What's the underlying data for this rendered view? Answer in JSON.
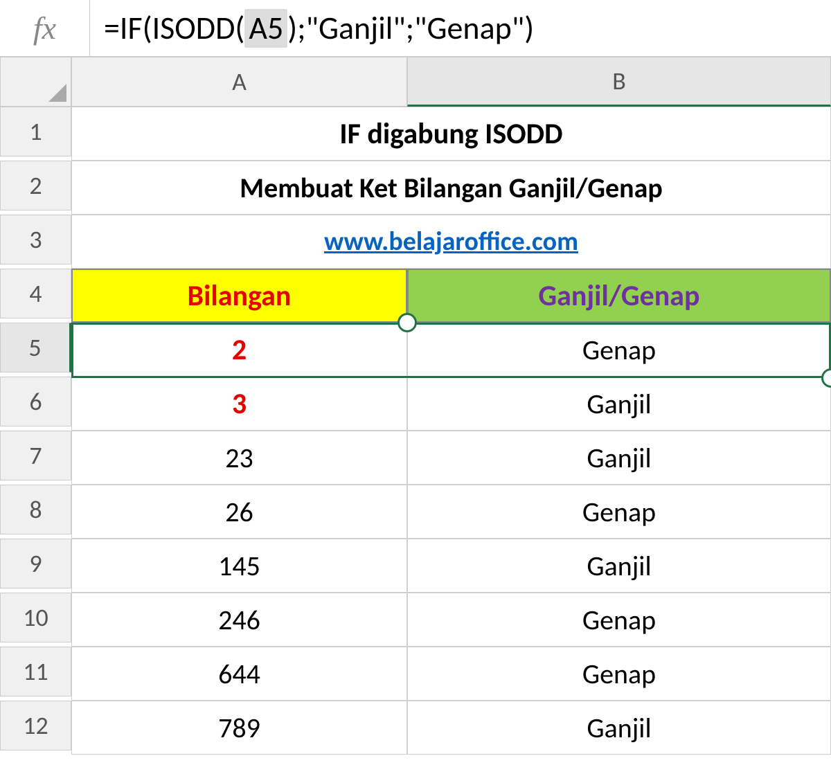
{
  "formula_bar": {
    "fx": "fx",
    "pre": "=IF(ISODD(",
    "ref": " A5 ",
    "post": ");\"Ganjil\";\"Genap\")"
  },
  "columns": [
    "A",
    "B"
  ],
  "rows": [
    "1",
    "2",
    "3",
    "4",
    "5",
    "6",
    "7",
    "8",
    "9",
    "10",
    "11",
    "12"
  ],
  "content": {
    "title1": "IF digabung ISODD",
    "title2": "Membuat Ket Bilangan Ganjil/Genap",
    "link": "www.belajaroffice.com",
    "headerA": "Bilangan",
    "headerB": "Ganjil/Genap"
  },
  "data": [
    {
      "num": "2",
      "result": "Genap",
      "red": true
    },
    {
      "num": "3",
      "result": "Ganjil",
      "red": true
    },
    {
      "num": "23",
      "result": "Ganjil",
      "red": false
    },
    {
      "num": "26",
      "result": "Genap",
      "red": false
    },
    {
      "num": "145",
      "result": "Ganjil",
      "red": false
    },
    {
      "num": "246",
      "result": "Genap",
      "red": false
    },
    {
      "num": "644",
      "result": "Genap",
      "red": false
    },
    {
      "num": "789",
      "result": "Ganjil",
      "red": false
    }
  ],
  "active": {
    "row": "5",
    "col": "B"
  }
}
